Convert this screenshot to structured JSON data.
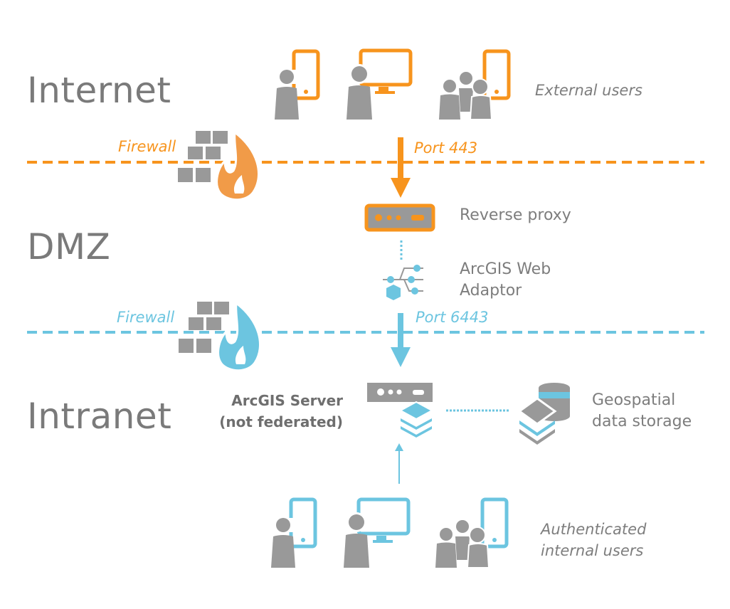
{
  "zones": {
    "internet": "Internet",
    "dmz": "DMZ",
    "intranet": "Intranet"
  },
  "firewalls": [
    {
      "label": "Firewall",
      "color": "#f7941d",
      "flame_color": "#f19b48"
    },
    {
      "label": "Firewall",
      "color": "#6cc5e0",
      "flame_color": "#6cc5e0"
    }
  ],
  "ports": {
    "external": "Port 443",
    "internal": "Port 6443"
  },
  "components": {
    "external_users": "External users",
    "reverse_proxy": "Reverse proxy",
    "web_adaptor_line1": "ArcGIS Web",
    "web_adaptor_line2": "Adaptor",
    "server_line1": "ArcGIS Server",
    "server_line2": "(not federated)",
    "storage_line1": "Geospatial",
    "storage_line2": "data storage",
    "internal_users_line1": "Authenticated",
    "internal_users_line2": "internal users"
  },
  "colors": {
    "orange": "#f7941d",
    "blue": "#6cc5e0",
    "gray": "#999999",
    "text_gray": "#7d7d7d"
  }
}
